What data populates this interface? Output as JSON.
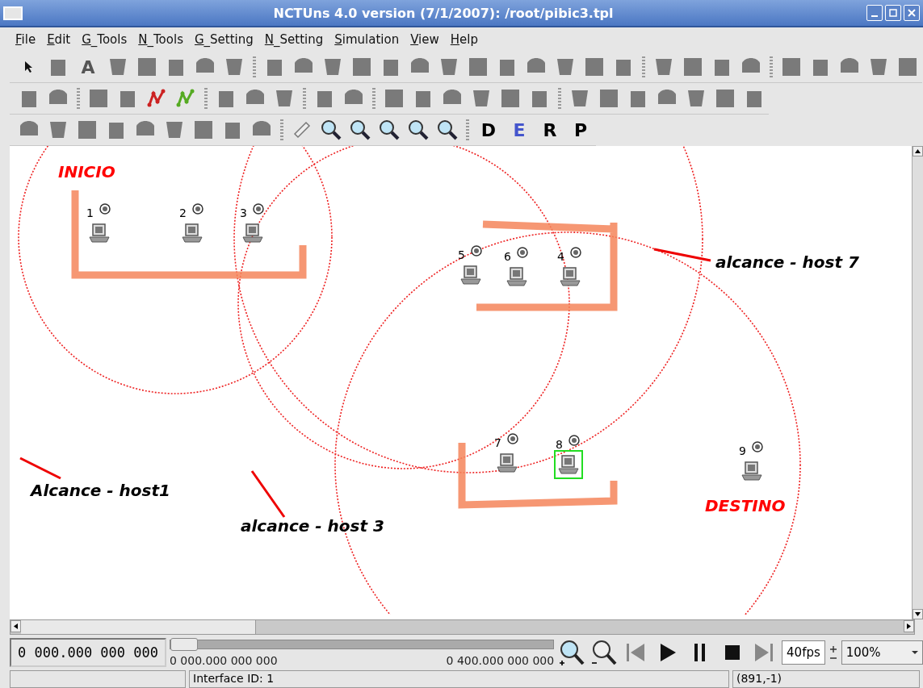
{
  "window": {
    "title": "NCTUns 4.0 version (7/1/2007): /root/pibic3.tpl"
  },
  "menu": [
    "File",
    "Edit",
    "G_Tools",
    "N_Tools",
    "G_Setting",
    "N_Setting",
    "Simulation",
    "View",
    "Help"
  ],
  "toolbars": [
    [
      {
        "kind": "pointer"
      },
      {
        "kind": "tool"
      },
      {
        "kind": "letter",
        "label": "A",
        "color": "#555555"
      },
      {
        "kind": "tool"
      },
      {
        "kind": "tool"
      },
      {
        "kind": "tool"
      },
      {
        "kind": "tool"
      },
      {
        "kind": "tool"
      },
      {
        "kind": "sep"
      },
      {
        "kind": "tool"
      },
      {
        "kind": "tool"
      },
      {
        "kind": "tool"
      },
      {
        "kind": "tool"
      },
      {
        "kind": "tool"
      },
      {
        "kind": "tool"
      },
      {
        "kind": "tool"
      },
      {
        "kind": "tool"
      },
      {
        "kind": "tool"
      },
      {
        "kind": "tool"
      },
      {
        "kind": "tool"
      },
      {
        "kind": "tool"
      },
      {
        "kind": "tool"
      },
      {
        "kind": "sep"
      },
      {
        "kind": "tool"
      },
      {
        "kind": "tool"
      },
      {
        "kind": "tool"
      },
      {
        "kind": "tool"
      },
      {
        "kind": "sep"
      },
      {
        "kind": "tool"
      },
      {
        "kind": "tool"
      },
      {
        "kind": "tool"
      },
      {
        "kind": "tool"
      },
      {
        "kind": "tool"
      }
    ],
    [
      {
        "kind": "tool"
      },
      {
        "kind": "tool"
      },
      {
        "kind": "sep"
      },
      {
        "kind": "tool"
      },
      {
        "kind": "tool"
      },
      {
        "kind": "graph",
        "color": "#cc2222"
      },
      {
        "kind": "graph",
        "color": "#55aa22"
      },
      {
        "kind": "sep"
      },
      {
        "kind": "tool"
      },
      {
        "kind": "tool"
      },
      {
        "kind": "tool"
      },
      {
        "kind": "sep"
      },
      {
        "kind": "tool"
      },
      {
        "kind": "tool"
      },
      {
        "kind": "sep"
      },
      {
        "kind": "tool"
      },
      {
        "kind": "tool"
      },
      {
        "kind": "tool"
      },
      {
        "kind": "tool"
      },
      {
        "kind": "tool"
      },
      {
        "kind": "tool"
      },
      {
        "kind": "sep"
      },
      {
        "kind": "tool"
      },
      {
        "kind": "tool"
      },
      {
        "kind": "tool"
      },
      {
        "kind": "tool"
      },
      {
        "kind": "tool"
      },
      {
        "kind": "tool"
      },
      {
        "kind": "tool"
      }
    ],
    [
      {
        "kind": "tool"
      },
      {
        "kind": "tool"
      },
      {
        "kind": "tool"
      },
      {
        "kind": "tool"
      },
      {
        "kind": "tool"
      },
      {
        "kind": "tool"
      },
      {
        "kind": "tool"
      },
      {
        "kind": "tool"
      },
      {
        "kind": "tool"
      },
      {
        "kind": "sep"
      },
      {
        "kind": "ruler"
      },
      {
        "kind": "zoom"
      },
      {
        "kind": "zoom"
      },
      {
        "kind": "zoom"
      },
      {
        "kind": "zoom"
      },
      {
        "kind": "zoom"
      },
      {
        "kind": "sep"
      },
      {
        "kind": "letter",
        "label": "D",
        "color": "#000000"
      },
      {
        "kind": "letter",
        "label": "E",
        "color": "#4455cc"
      },
      {
        "kind": "letter",
        "label": "R",
        "color": "#000000"
      },
      {
        "kind": "letter",
        "label": "P",
        "color": "#000000"
      }
    ]
  ],
  "canvas": {
    "nodes": [
      {
        "label": "1",
        "selected": false
      },
      {
        "label": "2",
        "selected": false
      },
      {
        "label": "3",
        "selected": false
      },
      {
        "label": "5",
        "selected": false
      },
      {
        "label": "6",
        "selected": false
      },
      {
        "label": "4",
        "selected": false
      },
      {
        "label": "7",
        "selected": false
      },
      {
        "label": "8",
        "selected": true
      },
      {
        "label": "9",
        "selected": false
      }
    ],
    "annotations": [
      {
        "text": "INICIO",
        "color": "#ff0000"
      },
      {
        "text": "Alcance - host1",
        "color": "#000000"
      },
      {
        "text": "alcance - host 3",
        "color": "#000000"
      },
      {
        "text": "alcance - host 7",
        "color": "#000000"
      },
      {
        "text": "DESTINO",
        "color": "#ff0000"
      }
    ]
  },
  "playback": {
    "clock": "0 000.000 000 000",
    "timeline": {
      "level": 0,
      "start": "0 000.000 000 000",
      "end": "0 400.000 000 000"
    },
    "fps": "40fps",
    "zoom": "100%"
  },
  "status_bar": {
    "message": "Interface ID: 1",
    "coordinates": "(891,-1)"
  }
}
